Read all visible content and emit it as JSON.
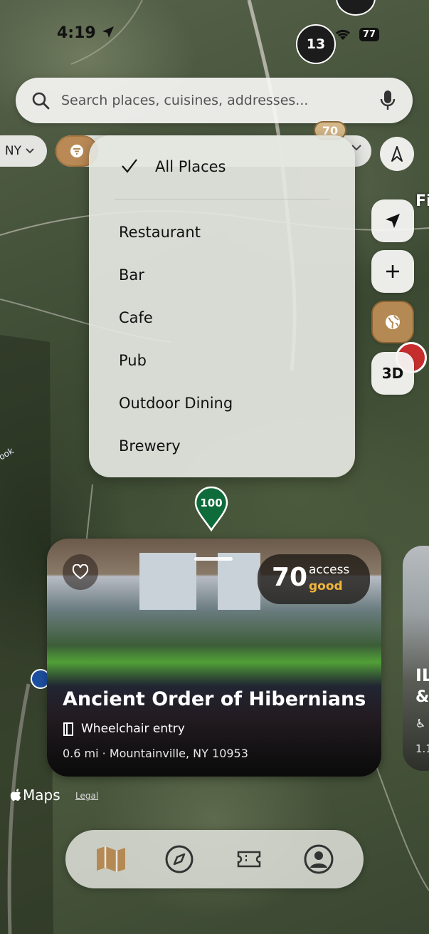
{
  "status": {
    "time": "4:19",
    "battery": "77"
  },
  "map": {
    "cluster_count": "13",
    "pin_score": "70",
    "pin_green": "100",
    "town_partial": "Fi",
    "road_label": "ook"
  },
  "search": {
    "placeholder": "Search places, cuisines, addresses..."
  },
  "filters": {
    "region_chip": "NY"
  },
  "dropdown": {
    "selected": "All Places",
    "options": [
      "Restaurant",
      "Bar",
      "Cafe",
      "Pub",
      "Outdoor Dining",
      "Brewery"
    ]
  },
  "controls": {
    "three_d": "3D"
  },
  "card": {
    "score": "70",
    "score_label": "access",
    "score_rating": "good",
    "title": "Ancient Order of Hibernians",
    "access_feature": "Wheelchair entry",
    "address": "0.6 mi · Mountainville, NY 10953"
  },
  "card2": {
    "t1": "IL",
    "t2": "&",
    "t4": "1.1"
  },
  "footer": {
    "maps": "Maps",
    "legal": "Legal"
  },
  "colors": {
    "accent_brown": "#b58954",
    "pin_green": "#0e6b3a",
    "rating_good": "#f2b53c"
  },
  "tabs": [
    "map-icon",
    "compass-icon",
    "ticket-icon",
    "profile-icon"
  ]
}
